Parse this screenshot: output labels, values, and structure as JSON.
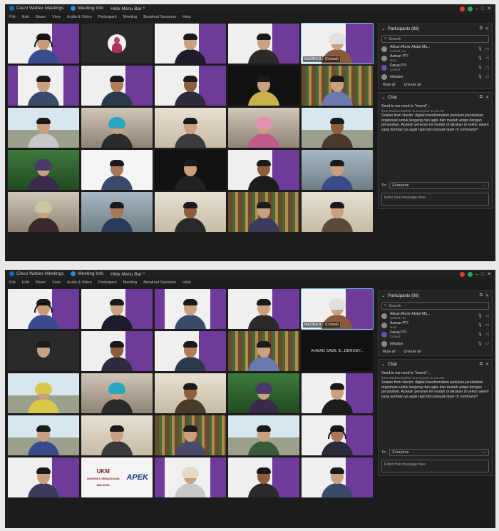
{
  "app": {
    "title": "Cisco Webex Meetings",
    "meeting_info": "Meeting Info",
    "hide_menu_bar": "Hide Menu Bar ^"
  },
  "menu": [
    "File",
    "Edit",
    "Share",
    "View",
    "Audio & Video",
    "Participant",
    "Meeting",
    "Breakout Sessions",
    "Help"
  ],
  "participants_panel": {
    "title": "Participants (88)",
    "search_placeholder": "Search",
    "items": [
      {
        "name": "Alfuan Munir Abdul Mu...",
        "role": "Cohost, me",
        "color": "#8a8a8a"
      },
      {
        "name": "Azman PTI",
        "role": "Host",
        "color": "#8a8a8a"
      },
      {
        "name": "Faruq PTI",
        "role": "Cohost",
        "color": "#6a4fb0"
      },
      {
        "name": "Infoukm",
        "role": "",
        "color": "#8a8a8a"
      }
    ],
    "mute_all": "Mute all",
    "unmute_all": "Unmute all"
  },
  "chat_panel": {
    "title": "Chat",
    "first_line": "Send to me need to \"invent\"...",
    "sender_meta": "from Roslina Ibrahim to everyone 11:32 AM",
    "message": "Soalan from Haslm: digital transformation perlukan perubahan organisasi untuk lengang dan agile dan mudah adapt dengan perubahan. Apakah peranan ini mudah di lakukan di sektor awam yang komitan ya agak rigid dan banyak layer of command?",
    "to_label": "To:",
    "to_value": "Everyone",
    "input_placeholder": "Enter chat message here"
  },
  "shot1_tiles": [
    {
      "bg": "bg-purple",
      "skin": "#c99a7a",
      "shirt": "#3a4c8c",
      "label": "",
      "headset": true
    },
    {
      "bg": "bg-gray",
      "avatar": true,
      "label": ""
    },
    {
      "bg": "bg-purple",
      "skin": "#c9a080",
      "shirt": "#1c1c2c",
      "label": ""
    },
    {
      "bg": "bg-purple",
      "skin": "#c9a080",
      "shirt": "#2a2a2a",
      "label": ""
    },
    {
      "bg": "bg-purple",
      "skin": "#c9a080",
      "shirt": "#8a5a3a",
      "label": "MAZIRA B... (Cohost)",
      "active": true,
      "hijab": "#e0e0e0"
    },
    {
      "bg": "bg-purple2",
      "skin": "#c9a080",
      "shirt": "#3a4a6a",
      "label": ""
    },
    {
      "bg": "bg-purple",
      "skin": "#b07c5a",
      "shirt": "#2a3a4a",
      "label": ""
    },
    {
      "bg": "bg-purple",
      "skin": "#8d5d3d",
      "shirt": "#2c2c3c",
      "label": ""
    },
    {
      "bg": "bg-dark",
      "skin": "#c9a080",
      "shirt": "#c9b24a",
      "label": ""
    },
    {
      "bg": "bg-shelf",
      "skin": "#c9a080",
      "shirt": "#6a7ab0",
      "label": ""
    },
    {
      "bg": "bg-window",
      "skin": "#c9a080",
      "shirt": "#c8c8c8",
      "label": ""
    },
    {
      "bg": "bg-office",
      "skin": "#c9a080",
      "shirt": "#2a2a2a",
      "label": "",
      "hijab": "#2aa6c0"
    },
    {
      "bg": "bg-beige",
      "skin": "#c9a080",
      "shirt": "#3c3c3c",
      "label": ""
    },
    {
      "bg": "bg-office",
      "skin": "#c9a080",
      "shirt": "#c05a8a",
      "label": "",
      "hijab": "#e090b0"
    },
    {
      "bg": "bg-window",
      "skin": "#8d5d3d",
      "shirt": "#4a3a2a",
      "label": ""
    },
    {
      "bg": "bg-green",
      "skin": "#c9a080",
      "shirt": "#3a2a4a",
      "label": "",
      "hijab": "#4a3a6a"
    },
    {
      "bg": "bg-white",
      "skin": "#a87858",
      "shirt": "#3a4a6a",
      "label": ""
    },
    {
      "bg": "bg-dark",
      "skin": "#c9a080",
      "shirt": "#222",
      "label": ""
    },
    {
      "bg": "bg-purple",
      "skin": "#8d5d3d",
      "shirt": "#1c1c1c",
      "label": ""
    },
    {
      "bg": "bg-room",
      "skin": "#c9a080",
      "shirt": "#3a4a8a",
      "label": ""
    },
    {
      "bg": "bg-office",
      "skin": "#c9a080",
      "shirt": "#3a2a2a",
      "label": "",
      "hijab": "#c8c8a0"
    },
    {
      "bg": "bg-room",
      "skin": "#a87858",
      "shirt": "#2a3a5a",
      "label": ""
    },
    {
      "bg": "bg-beige",
      "skin": "#8d5d3d",
      "shirt": "#2a2a2a",
      "label": ""
    },
    {
      "bg": "bg-shelf",
      "skin": "#c9a080",
      "shirt": "#3a3a5a",
      "label": ""
    },
    {
      "bg": "bg-beige",
      "skin": "#c9a080",
      "shirt": "#5a4a3a",
      "label": ""
    }
  ],
  "shot2_tiles": [
    {
      "bg": "bg-purple",
      "skin": "#c99a7a",
      "shirt": "#3a4c8c",
      "label": "",
      "headset": true
    },
    {
      "bg": "bg-purple",
      "skin": "#c9a080",
      "shirt": "#1c1c2c",
      "label": ""
    },
    {
      "bg": "bg-purple2",
      "skin": "#c9a080",
      "shirt": "#3a4a6a",
      "label": ""
    },
    {
      "bg": "bg-purple",
      "skin": "#c9a080",
      "shirt": "#2a2a2a",
      "label": ""
    },
    {
      "bg": "bg-purple",
      "skin": "#c9a080",
      "shirt": "#8a5a3a",
      "label": "MAZIRA B... (Cohost)",
      "active": true,
      "hijab": "#e0e0e0"
    },
    {
      "bg": "bg-gray",
      "skin": "#c9a080",
      "shirt": "#2a2a2a",
      "label": ""
    },
    {
      "bg": "bg-purple",
      "skin": "#8d5d3d",
      "shirt": "#2c2c3c",
      "label": ""
    },
    {
      "bg": "bg-purple",
      "skin": "#b07c5a",
      "shirt": "#2a3a4a",
      "label": ""
    },
    {
      "bg": "bg-shelf",
      "skin": "#c9a080",
      "shirt": "#6a7ab0",
      "label": ""
    },
    {
      "bg": "bg-dark",
      "name_only": "AHMAD SABIL B...DEROBY...",
      "label": ""
    },
    {
      "bg": "bg-window",
      "skin": "#c9a080",
      "shirt": "#d8c84a",
      "label": "",
      "hijab": "#d8c84a"
    },
    {
      "bg": "bg-office",
      "skin": "#c9a080",
      "shirt": "#2a2a2a",
      "label": "",
      "hijab": "#2aa6c0"
    },
    {
      "bg": "bg-beige",
      "skin": "#8d5d3d",
      "shirt": "#4a3a2a",
      "label": ""
    },
    {
      "bg": "bg-green",
      "skin": "#c9a080",
      "shirt": "#3a2a4a",
      "label": "",
      "hijab": "#4a3a6a"
    },
    {
      "bg": "bg-purple",
      "skin": "#c9a080",
      "shirt": "#1c1c1c",
      "label": ""
    },
    {
      "bg": "bg-window",
      "skin": "#c9a080",
      "shirt": "#3a4a8a",
      "label": ""
    },
    {
      "bg": "bg-beige",
      "skin": "#c9a080",
      "shirt": "#3a3a3a",
      "label": ""
    },
    {
      "bg": "bg-shelf",
      "skin": "#c9a080",
      "shirt": "#4a4a6a",
      "label": ""
    },
    {
      "bg": "bg-window",
      "skin": "#c9a080",
      "shirt": "#3a5a3a",
      "label": ""
    },
    {
      "bg": "bg-purple",
      "skin": "#a87858",
      "shirt": "#2a2a3a",
      "label": "",
      "headset": true
    },
    {
      "bg": "bg-purple",
      "skin": "#c9a080",
      "shirt": "#3a3a5a",
      "label": ""
    },
    {
      "bg": "bg-white",
      "logo": true,
      "logo_ukm": "UKM",
      "logo_sub": "UNIVERSITI KEBANGSAAN MALAYSIA",
      "logo_apek": "APEK",
      "label": ""
    },
    {
      "bg": "bg-purple2",
      "skin": "#c9a080",
      "shirt": "#c8c8c8",
      "label": "",
      "hijab": "#e8d8c8"
    },
    {
      "bg": "bg-purple",
      "skin": "#8d5d3d",
      "shirt": "#2a2a2a",
      "label": ""
    },
    {
      "bg": "bg-purple",
      "skin": "#c9a080",
      "shirt": "#3a4a6a",
      "label": ""
    }
  ]
}
